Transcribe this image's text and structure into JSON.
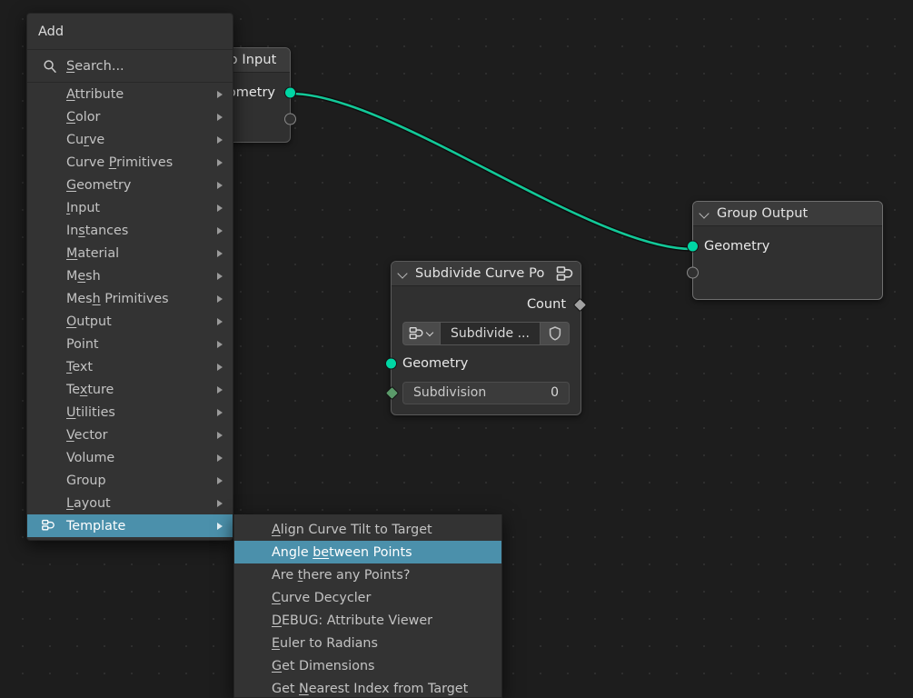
{
  "editor": {
    "background_color": "#1d1d1d",
    "grid_dot_color": "#2e2e2e",
    "link_color": "#00d6a4",
    "highlight_color": "#4b90ab"
  },
  "nodes": {
    "group_input": {
      "title": "Group Input",
      "outputs": [
        {
          "label": "Geometry",
          "socket": "geometry",
          "color": "#00d6a4"
        },
        {
          "label": "",
          "socket": "empty",
          "color": "#8a8a8a"
        }
      ]
    },
    "subdivide_curve": {
      "title": "Subdivide Curve Po",
      "header_icon": "node-group-icon",
      "outputs": [
        {
          "label": "Count",
          "socket": "field-diamond",
          "color": "#a1a1a1"
        }
      ],
      "group_selector": {
        "browse_icon": "node-group-icon",
        "dropdown_icon": "chevron-down-icon",
        "name": "Subdivide ...",
        "fake_user_icon": "shield-icon"
      },
      "inputs": [
        {
          "label": "Geometry",
          "socket": "geometry",
          "color": "#00d6a4"
        }
      ],
      "fields": [
        {
          "label": "Subdivision",
          "value": "0",
          "socket": "field-diamond",
          "color": "#5b9a6a"
        }
      ]
    },
    "group_output": {
      "title": "Group Output",
      "inputs": [
        {
          "label": "Geometry",
          "socket": "geometry",
          "color": "#00d6a4"
        },
        {
          "label": "",
          "socket": "empty",
          "color": "#8a8a8a"
        }
      ]
    }
  },
  "add_menu": {
    "title": "Add",
    "search": {
      "icon": "search-icon",
      "label": "Search...",
      "accel": "S"
    },
    "items": [
      {
        "label": "Attribute",
        "accel": "A",
        "has_submenu": true,
        "selected": false
      },
      {
        "label": "Color",
        "accel": "C",
        "has_submenu": true,
        "selected": false
      },
      {
        "label": "Curve",
        "accel": "r",
        "has_submenu": true,
        "selected": false
      },
      {
        "label": "Curve Primitives",
        "accel": "P",
        "has_submenu": true,
        "selected": false
      },
      {
        "label": "Geometry",
        "accel": "G",
        "has_submenu": true,
        "selected": false
      },
      {
        "label": "Input",
        "accel": "I",
        "has_submenu": true,
        "selected": false
      },
      {
        "label": "Instances",
        "accel": "s",
        "has_submenu": true,
        "selected": false
      },
      {
        "label": "Material",
        "accel": "M",
        "has_submenu": true,
        "selected": false
      },
      {
        "label": "Mesh",
        "accel": "e",
        "has_submenu": true,
        "selected": false
      },
      {
        "label": "Mesh Primitives",
        "accel": "h",
        "has_submenu": true,
        "selected": false
      },
      {
        "label": "Output",
        "accel": "O",
        "has_submenu": true,
        "selected": false
      },
      {
        "label": "Point",
        "accel": "",
        "has_submenu": true,
        "selected": false
      },
      {
        "label": "Text",
        "accel": "T",
        "has_submenu": true,
        "selected": false
      },
      {
        "label": "Texture",
        "accel": "x",
        "has_submenu": true,
        "selected": false
      },
      {
        "label": "Utilities",
        "accel": "U",
        "has_submenu": true,
        "selected": false
      },
      {
        "label": "Vector",
        "accel": "V",
        "has_submenu": true,
        "selected": false
      },
      {
        "label": "Volume",
        "accel": "",
        "has_submenu": true,
        "selected": false
      },
      {
        "label": "Group",
        "accel": "",
        "has_submenu": true,
        "selected": false
      },
      {
        "label": "Layout",
        "accel": "L",
        "has_submenu": true,
        "selected": false
      },
      {
        "label": "Template",
        "accel": "",
        "has_submenu": true,
        "selected": true,
        "icon": "node-group-icon"
      }
    ]
  },
  "submenu": {
    "parent": "Template",
    "items": [
      {
        "label": "Align Curve Tilt to Target",
        "accel": "A",
        "selected": false
      },
      {
        "label": "Angle between Points",
        "accel": "be",
        "selected": true
      },
      {
        "label": "Are there any Points?",
        "accel": "t",
        "selected": false
      },
      {
        "label": "Curve Decycler",
        "accel": "C",
        "selected": false
      },
      {
        "label": "DEBUG: Attribute Viewer",
        "accel": "D",
        "selected": false
      },
      {
        "label": "Euler to Radians",
        "accel": "E",
        "selected": false
      },
      {
        "label": "Get Dimensions",
        "accel": "G",
        "selected": false
      },
      {
        "label": "Get Nearest Index from Target",
        "accel": "N",
        "selected": false
      }
    ]
  }
}
